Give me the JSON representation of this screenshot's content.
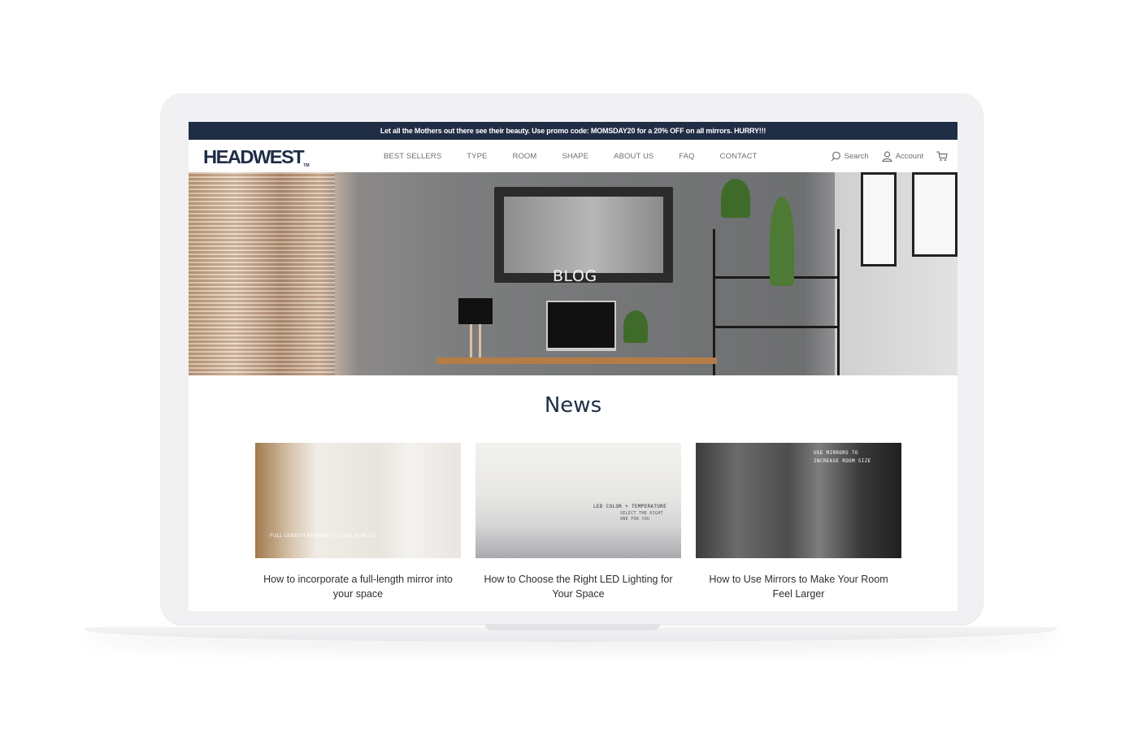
{
  "promo": {
    "text": "Let all the Mothers out there see their beauty. Use promo code: MOMSDAY20 for a 20% OFF on all mirrors. HURRY!!!"
  },
  "header": {
    "logo": "HEADWEST",
    "logo_tm": "TM",
    "nav": [
      "BEST SELLERS",
      "TYPE",
      "ROOM",
      "SHAPE",
      "ABOUT US",
      "FAQ",
      "CONTACT"
    ],
    "search_label": "Search",
    "account_label": "Account",
    "icons": {
      "search": "search-icon",
      "account": "user-icon",
      "cart": "cart-icon"
    }
  },
  "hero": {
    "title": "BLOG"
  },
  "news": {
    "title": "News",
    "cards": [
      {
        "caption": "How to incorporate a full-length mirror into your space",
        "image_text": "FULL LENGTH MIRROR STYLING HOW TO"
      },
      {
        "caption": "How to Choose the Right LED Lighting for Your Space",
        "image_text_line1": "LED COLOR + TEMPERATURE",
        "image_text_line2": "SELECT THE RIGHT",
        "image_text_line3": "ONE FOR YOU"
      },
      {
        "caption": "How to Use Mirrors to Make Your Room Feel Larger",
        "image_text_line1": "USE MIRRORS TO",
        "image_text_line2": "INCREASE ROOM SIZE"
      }
    ]
  },
  "colors": {
    "navy": "#1f2d45",
    "nav_text": "#6b6f75",
    "laptop": "#f1f1f3"
  }
}
